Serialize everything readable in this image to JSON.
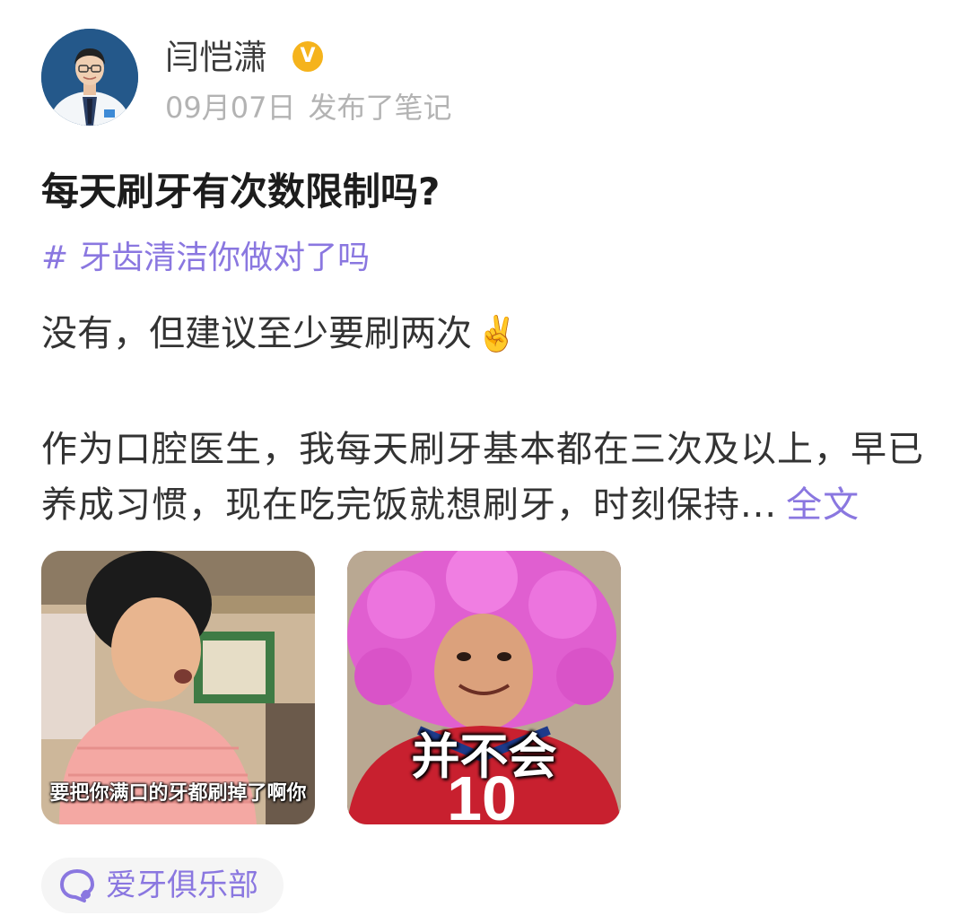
{
  "author": {
    "name": "闫恺潇",
    "verified_badge": "V",
    "date": "09月07日",
    "action": "发布了笔记"
  },
  "post": {
    "title": "每天刷牙有次数限制吗?",
    "topic_hash": "#",
    "topic": "牙齿清洁你做对了吗",
    "answer": "没有，但建议至少要刷两次",
    "answer_emoji": "✌️",
    "body": "作为口腔医生，我每天刷牙基本都在三次及以上，早已养成习惯，现在吃完饭就想刷牙，时刻保持...",
    "read_more": "全文"
  },
  "images": [
    {
      "caption": "要把你满口的牙都刷掉了啊你"
    },
    {
      "caption": "并不会"
    }
  ],
  "community": {
    "icon": "chat-bubble-icon",
    "name": "爱牙俱乐部"
  },
  "colors": {
    "accent": "#8a77e0",
    "verified": "#f5b31c",
    "meta_text": "#b3b3b3"
  }
}
